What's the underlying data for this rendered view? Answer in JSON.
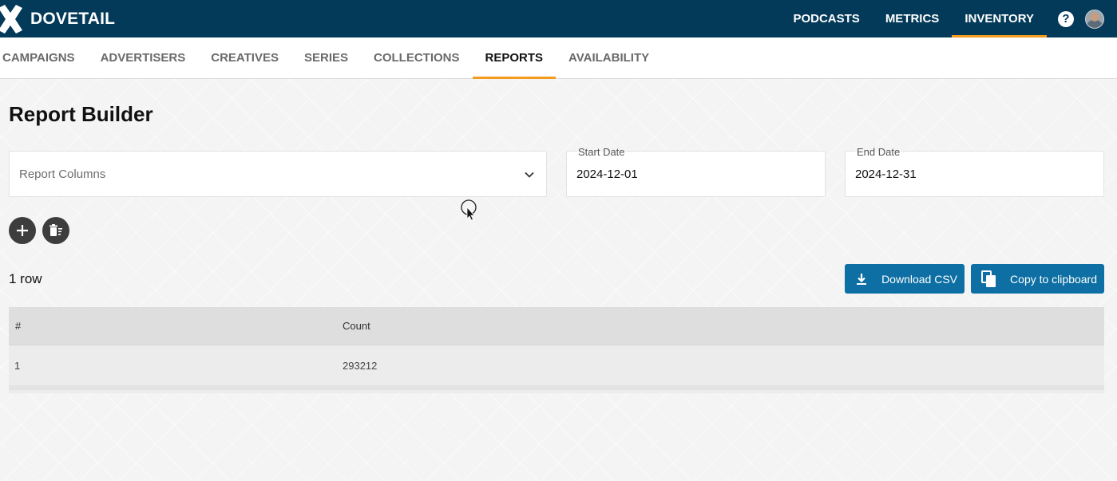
{
  "topbar": {
    "brand": "DOVETAIL",
    "nav": [
      {
        "label": "PODCASTS",
        "active": false
      },
      {
        "label": "METRICS",
        "active": false
      },
      {
        "label": "INVENTORY",
        "active": true
      }
    ],
    "help_glyph": "?",
    "accent_color": "#f39b1f",
    "bar_color": "#033a59"
  },
  "subnav": {
    "items": [
      {
        "label": "CAMPAIGNS",
        "active": false
      },
      {
        "label": "ADVERTISERS",
        "active": false
      },
      {
        "label": "CREATIVES",
        "active": false
      },
      {
        "label": "SERIES",
        "active": false
      },
      {
        "label": "COLLECTIONS",
        "active": false
      },
      {
        "label": "REPORTS",
        "active": true
      },
      {
        "label": "AVAILABILITY",
        "active": false
      }
    ]
  },
  "page": {
    "title": "Report Builder",
    "columns_select": {
      "placeholder": "Report Columns"
    },
    "start_date": {
      "label": "Start Date",
      "value": "2024-12-01"
    },
    "end_date": {
      "label": "End Date",
      "value": "2024-12-31"
    },
    "row_count": "1 row",
    "buttons": {
      "download_csv": "Download CSV",
      "copy_clipboard": "Copy to clipboard",
      "button_color": "#0d6fa3"
    },
    "table": {
      "headers": [
        "#",
        "Count"
      ],
      "rows": [
        [
          "1",
          "293212"
        ]
      ]
    }
  }
}
